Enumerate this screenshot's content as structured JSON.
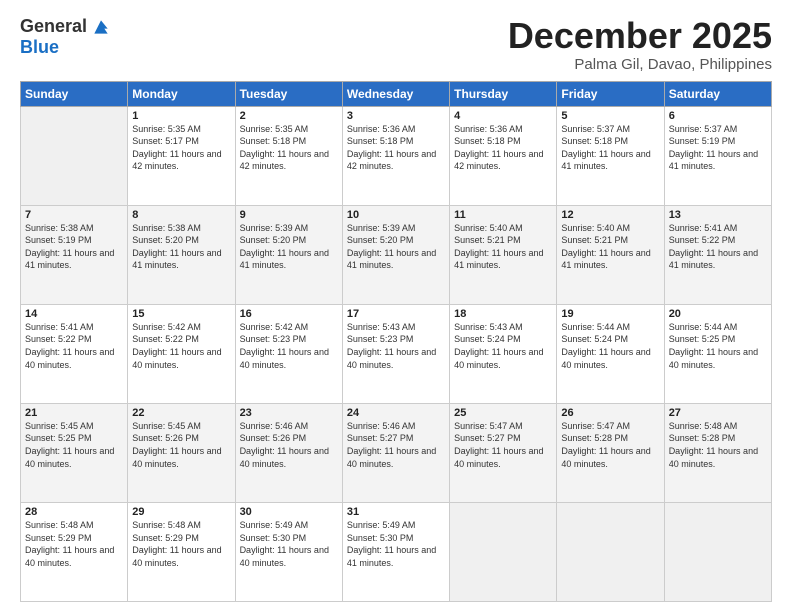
{
  "logo": {
    "general": "General",
    "blue": "Blue"
  },
  "header": {
    "month": "December 2025",
    "location": "Palma Gil, Davao, Philippines"
  },
  "days_of_week": [
    "Sunday",
    "Monday",
    "Tuesday",
    "Wednesday",
    "Thursday",
    "Friday",
    "Saturday"
  ],
  "weeks": [
    [
      {
        "day": "",
        "sunrise": "",
        "sunset": "",
        "daylight": ""
      },
      {
        "day": "1",
        "sunrise": "Sunrise: 5:35 AM",
        "sunset": "Sunset: 5:17 PM",
        "daylight": "Daylight: 11 hours and 42 minutes."
      },
      {
        "day": "2",
        "sunrise": "Sunrise: 5:35 AM",
        "sunset": "Sunset: 5:18 PM",
        "daylight": "Daylight: 11 hours and 42 minutes."
      },
      {
        "day": "3",
        "sunrise": "Sunrise: 5:36 AM",
        "sunset": "Sunset: 5:18 PM",
        "daylight": "Daylight: 11 hours and 42 minutes."
      },
      {
        "day": "4",
        "sunrise": "Sunrise: 5:36 AM",
        "sunset": "Sunset: 5:18 PM",
        "daylight": "Daylight: 11 hours and 42 minutes."
      },
      {
        "day": "5",
        "sunrise": "Sunrise: 5:37 AM",
        "sunset": "Sunset: 5:18 PM",
        "daylight": "Daylight: 11 hours and 41 minutes."
      },
      {
        "day": "6",
        "sunrise": "Sunrise: 5:37 AM",
        "sunset": "Sunset: 5:19 PM",
        "daylight": "Daylight: 11 hours and 41 minutes."
      }
    ],
    [
      {
        "day": "7",
        "sunrise": "Sunrise: 5:38 AM",
        "sunset": "Sunset: 5:19 PM",
        "daylight": "Daylight: 11 hours and 41 minutes."
      },
      {
        "day": "8",
        "sunrise": "Sunrise: 5:38 AM",
        "sunset": "Sunset: 5:20 PM",
        "daylight": "Daylight: 11 hours and 41 minutes."
      },
      {
        "day": "9",
        "sunrise": "Sunrise: 5:39 AM",
        "sunset": "Sunset: 5:20 PM",
        "daylight": "Daylight: 11 hours and 41 minutes."
      },
      {
        "day": "10",
        "sunrise": "Sunrise: 5:39 AM",
        "sunset": "Sunset: 5:20 PM",
        "daylight": "Daylight: 11 hours and 41 minutes."
      },
      {
        "day": "11",
        "sunrise": "Sunrise: 5:40 AM",
        "sunset": "Sunset: 5:21 PM",
        "daylight": "Daylight: 11 hours and 41 minutes."
      },
      {
        "day": "12",
        "sunrise": "Sunrise: 5:40 AM",
        "sunset": "Sunset: 5:21 PM",
        "daylight": "Daylight: 11 hours and 41 minutes."
      },
      {
        "day": "13",
        "sunrise": "Sunrise: 5:41 AM",
        "sunset": "Sunset: 5:22 PM",
        "daylight": "Daylight: 11 hours and 41 minutes."
      }
    ],
    [
      {
        "day": "14",
        "sunrise": "Sunrise: 5:41 AM",
        "sunset": "Sunset: 5:22 PM",
        "daylight": "Daylight: 11 hours and 40 minutes."
      },
      {
        "day": "15",
        "sunrise": "Sunrise: 5:42 AM",
        "sunset": "Sunset: 5:22 PM",
        "daylight": "Daylight: 11 hours and 40 minutes."
      },
      {
        "day": "16",
        "sunrise": "Sunrise: 5:42 AM",
        "sunset": "Sunset: 5:23 PM",
        "daylight": "Daylight: 11 hours and 40 minutes."
      },
      {
        "day": "17",
        "sunrise": "Sunrise: 5:43 AM",
        "sunset": "Sunset: 5:23 PM",
        "daylight": "Daylight: 11 hours and 40 minutes."
      },
      {
        "day": "18",
        "sunrise": "Sunrise: 5:43 AM",
        "sunset": "Sunset: 5:24 PM",
        "daylight": "Daylight: 11 hours and 40 minutes."
      },
      {
        "day": "19",
        "sunrise": "Sunrise: 5:44 AM",
        "sunset": "Sunset: 5:24 PM",
        "daylight": "Daylight: 11 hours and 40 minutes."
      },
      {
        "day": "20",
        "sunrise": "Sunrise: 5:44 AM",
        "sunset": "Sunset: 5:25 PM",
        "daylight": "Daylight: 11 hours and 40 minutes."
      }
    ],
    [
      {
        "day": "21",
        "sunrise": "Sunrise: 5:45 AM",
        "sunset": "Sunset: 5:25 PM",
        "daylight": "Daylight: 11 hours and 40 minutes."
      },
      {
        "day": "22",
        "sunrise": "Sunrise: 5:45 AM",
        "sunset": "Sunset: 5:26 PM",
        "daylight": "Daylight: 11 hours and 40 minutes."
      },
      {
        "day": "23",
        "sunrise": "Sunrise: 5:46 AM",
        "sunset": "Sunset: 5:26 PM",
        "daylight": "Daylight: 11 hours and 40 minutes."
      },
      {
        "day": "24",
        "sunrise": "Sunrise: 5:46 AM",
        "sunset": "Sunset: 5:27 PM",
        "daylight": "Daylight: 11 hours and 40 minutes."
      },
      {
        "day": "25",
        "sunrise": "Sunrise: 5:47 AM",
        "sunset": "Sunset: 5:27 PM",
        "daylight": "Daylight: 11 hours and 40 minutes."
      },
      {
        "day": "26",
        "sunrise": "Sunrise: 5:47 AM",
        "sunset": "Sunset: 5:28 PM",
        "daylight": "Daylight: 11 hours and 40 minutes."
      },
      {
        "day": "27",
        "sunrise": "Sunrise: 5:48 AM",
        "sunset": "Sunset: 5:28 PM",
        "daylight": "Daylight: 11 hours and 40 minutes."
      }
    ],
    [
      {
        "day": "28",
        "sunrise": "Sunrise: 5:48 AM",
        "sunset": "Sunset: 5:29 PM",
        "daylight": "Daylight: 11 hours and 40 minutes."
      },
      {
        "day": "29",
        "sunrise": "Sunrise: 5:48 AM",
        "sunset": "Sunset: 5:29 PM",
        "daylight": "Daylight: 11 hours and 40 minutes."
      },
      {
        "day": "30",
        "sunrise": "Sunrise: 5:49 AM",
        "sunset": "Sunset: 5:30 PM",
        "daylight": "Daylight: 11 hours and 40 minutes."
      },
      {
        "day": "31",
        "sunrise": "Sunrise: 5:49 AM",
        "sunset": "Sunset: 5:30 PM",
        "daylight": "Daylight: 11 hours and 41 minutes."
      },
      {
        "day": "",
        "sunrise": "",
        "sunset": "",
        "daylight": ""
      },
      {
        "day": "",
        "sunrise": "",
        "sunset": "",
        "daylight": ""
      },
      {
        "day": "",
        "sunrise": "",
        "sunset": "",
        "daylight": ""
      }
    ]
  ]
}
